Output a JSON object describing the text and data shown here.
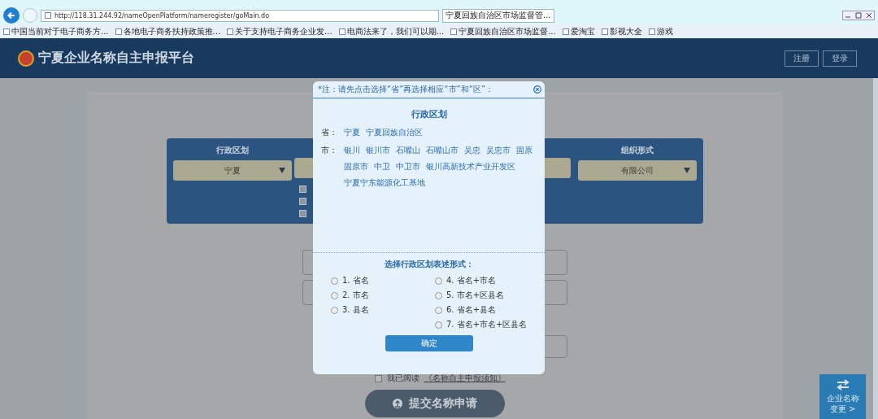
{
  "browser": {
    "address": "http://118.31.244.92/nameOpenPlatform/nameregister/goMain.do",
    "tab": {
      "title": "宁夏回族自治区市场监督管...",
      "selected": true
    },
    "bookmarks": [
      "中国当前对于电子商务方...",
      "各地电子商务扶持政策推...",
      "关于支持电子商务企业发...",
      "电商法来了，我们可以期...",
      "宁夏回族自治区市场监督...",
      "爱淘宝",
      "影视大全",
      "游戏"
    ]
  },
  "header": {
    "title": "宁夏企业名称自主申报平台",
    "buttons": [
      "注册",
      "登录"
    ]
  },
  "form": {
    "columns": [
      {
        "heading": "行政区划",
        "value": "宁夏"
      },
      {
        "heading": "组织形式",
        "value": "有限公司"
      }
    ],
    "checkboxes": [
      {
        "checked": false
      },
      {
        "checked": false
      },
      {
        "checked": false
      }
    ],
    "agreement": {
      "checked": false,
      "text": "我已阅读",
      "link": "《名称自主申报须知》"
    },
    "submit": "提交名称申请"
  },
  "side_button": {
    "lines": [
      "企业名称",
      "变更 >"
    ]
  },
  "dialog": {
    "note": "*注：请先点击选择“省”再选择相应“市”和“区”：",
    "title": "行政区划",
    "province": {
      "label": "省：",
      "items": [
        "宁夏",
        "宁夏回族自治区"
      ]
    },
    "city": {
      "label": "市：",
      "items": [
        "银川",
        "银川市",
        "石嘴山",
        "石嘴山市",
        "吴忠",
        "吴忠市",
        "固原",
        "固原市",
        "中卫",
        "中卫市",
        "银川高新技术产业开发区",
        "宁夏宁东能源化工基地"
      ]
    },
    "format_title": "选择行政区划表述形式：",
    "options": [
      {
        "label": "1. 省名",
        "selected": false
      },
      {
        "label": "2. 市名",
        "selected": false
      },
      {
        "label": "3. 县名",
        "selected": false
      },
      {
        "label": "4. 省名+市名",
        "selected": false
      },
      {
        "label": "5. 市名+区县名",
        "selected": false
      },
      {
        "label": "6. 省名+县名",
        "selected": false
      },
      {
        "label": "7. 省名+市名+区县名",
        "selected": false
      }
    ],
    "confirm": "确定"
  }
}
